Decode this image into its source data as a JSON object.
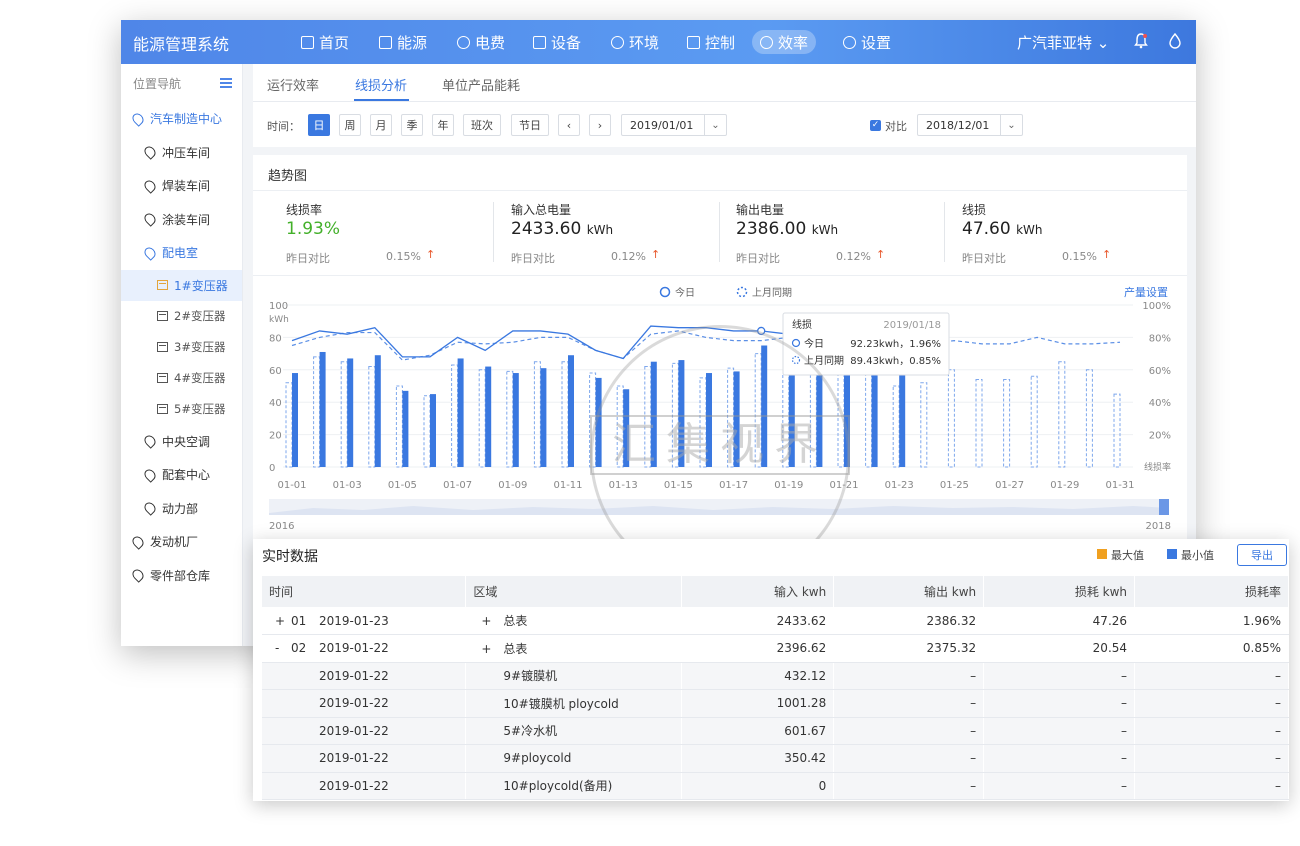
{
  "app_title": "能源管理系统",
  "nav": [
    {
      "label": "首页",
      "icon": "chart-icon"
    },
    {
      "label": "能源",
      "icon": "database-icon"
    },
    {
      "label": "电费",
      "icon": "bulb-icon"
    },
    {
      "label": "设备",
      "icon": "device-icon"
    },
    {
      "label": "环境",
      "icon": "leaf-icon"
    },
    {
      "label": "控制",
      "icon": "monitor-icon"
    },
    {
      "label": "效率",
      "icon": "clock-icon"
    },
    {
      "label": "设置",
      "icon": "gear-icon"
    }
  ],
  "company": "广汽菲亚特",
  "sidebar": {
    "header": "位置导航",
    "items": [
      {
        "label": "汽车制造中心"
      },
      {
        "label": "冲压车间"
      },
      {
        "label": "焊装车间"
      },
      {
        "label": "涂装车间"
      },
      {
        "label": "配电室"
      },
      {
        "label": "1#变压器"
      },
      {
        "label": "2#变压器"
      },
      {
        "label": "3#变压器"
      },
      {
        "label": "4#变压器"
      },
      {
        "label": "5#变压器"
      },
      {
        "label": "中央空调"
      },
      {
        "label": "配套中心"
      },
      {
        "label": "动力部"
      },
      {
        "label": "发动机厂"
      },
      {
        "label": "零件部仓库"
      }
    ]
  },
  "tabs": [
    "运行效率",
    "线损分析",
    "单位产品能耗"
  ],
  "filter": {
    "time_label": "时间：",
    "buttons": [
      "日",
      "周",
      "月",
      "季",
      "年",
      "班次",
      "节日"
    ],
    "prev": "‹",
    "next": "›",
    "date": "2019/01/01",
    "compare_label": "对比",
    "compare_date": "2018/12/01"
  },
  "trend": {
    "title": "趋势图",
    "kpis": [
      {
        "label": "线损率",
        "value": "1.93%",
        "unit": "",
        "cmp": "昨日对比",
        "pct": "0.15%"
      },
      {
        "label": "输入总电量",
        "value": "2433.60",
        "unit": "kWh",
        "cmp": "昨日对比",
        "pct": "0.12%"
      },
      {
        "label": "输出电量",
        "value": "2386.00",
        "unit": "kWh",
        "cmp": "昨日对比",
        "pct": "0.12%"
      },
      {
        "label": "线损",
        "value": "47.60",
        "unit": "kWh",
        "cmp": "昨日对比",
        "pct": "0.15%"
      }
    ],
    "arrow": "↑",
    "legend_today": "今日",
    "legend_lastmonth": "上月同期",
    "settings_link": "产量设置",
    "tooltip": {
      "title": "线损",
      "date": "2019/01/18",
      "today_label": "今日",
      "today_value": "92.23kwh，1.96%",
      "last_label": "上月同期",
      "last_value": "89.43kwh，0.85%"
    },
    "range_start": "2016",
    "range_end": "2018"
  },
  "chart_data": {
    "type": "bar",
    "categories": [
      "01-01",
      "01-02",
      "01-03",
      "01-04",
      "01-05",
      "01-06",
      "01-07",
      "01-08",
      "01-09",
      "01-10",
      "01-11",
      "01-12",
      "01-13",
      "01-14",
      "01-15",
      "01-16",
      "01-17",
      "01-18",
      "01-19",
      "01-20",
      "01-21",
      "01-22",
      "01-23",
      "01-24",
      "01-25",
      "01-26",
      "01-27",
      "01-28",
      "01-29",
      "01-30",
      "01-31"
    ],
    "tick_labels": [
      "01-01",
      "01-03",
      "01-05",
      "01-07",
      "01-09",
      "01-11",
      "01-13",
      "01-15",
      "01-17",
      "01-19",
      "01-21",
      "01-23",
      "01-25",
      "01-27",
      "01-29",
      "01-31"
    ],
    "ylabel_left": "kWh",
    "ylabel_right": "线损率",
    "left_ticks": [
      "100",
      "80",
      "60",
      "40",
      "20",
      "0"
    ],
    "right_ticks": [
      "100%",
      "80%",
      "60%",
      "40%",
      "20%"
    ],
    "ylim": [
      0,
      100
    ],
    "series": [
      {
        "name": "今日",
        "kind": "bar",
        "values": [
          58,
          71,
          67,
          69,
          47,
          45,
          67,
          62,
          58,
          61,
          69,
          55,
          48,
          65,
          66,
          58,
          59,
          75,
          60,
          60,
          64,
          69,
          57,
          null,
          null,
          null,
          null,
          null,
          null,
          null,
          null
        ]
      },
      {
        "name": "上月同期",
        "kind": "bar-dashed",
        "values": [
          52,
          68,
          65,
          62,
          50,
          44,
          63,
          60,
          59,
          65,
          65,
          58,
          50,
          62,
          64,
          55,
          61,
          70,
          58,
          61,
          63,
          66,
          50,
          52,
          60,
          54,
          54,
          56,
          65,
          60,
          45
        ]
      },
      {
        "name": "今日",
        "kind": "line",
        "values": [
          78,
          84,
          82,
          86,
          68,
          68,
          80,
          72,
          84,
          84,
          82,
          72,
          67,
          87,
          86,
          86,
          84,
          84,
          82,
          86,
          84,
          82,
          null,
          null,
          null,
          null,
          null,
          null,
          null,
          null,
          null
        ]
      },
      {
        "name": "上月同期",
        "kind": "line-dashed",
        "values": [
          75,
          80,
          83,
          83,
          66,
          69,
          77,
          76,
          77,
          80,
          80,
          72,
          67,
          82,
          84,
          80,
          78,
          78,
          80,
          84,
          80,
          81,
          80,
          76,
          78,
          76,
          76,
          80,
          76,
          76,
          77
        ]
      }
    ]
  },
  "realtime": {
    "title": "实时数据",
    "legend_max": "最大值",
    "legend_min": "最小值",
    "export": "导出",
    "colors": {
      "max": "#f0a020",
      "min": "#3a78e0"
    },
    "columns": [
      "时间",
      "区域",
      "输入 kwh",
      "输出 kwh",
      "损耗 kwh",
      "损耗率"
    ],
    "rows": [
      {
        "exp": "+",
        "idx": "01",
        "date": "2019-01-23",
        "exp2": "+",
        "area": "总表",
        "in": "2433.62",
        "out": "2386.32",
        "loss": "47.26",
        "rate": "1.96%",
        "sub": false
      },
      {
        "exp": "-",
        "idx": "02",
        "date": "2019-01-22",
        "exp2": "+",
        "area": "总表",
        "in": "2396.62",
        "out": "2375.32",
        "loss": "20.54",
        "rate": "0.85%",
        "sub": false
      },
      {
        "exp": "",
        "idx": "",
        "date": "2019-01-22",
        "exp2": "",
        "area": "9#镀膜机",
        "in": "432.12",
        "out": "–",
        "loss": "–",
        "rate": "–",
        "sub": true
      },
      {
        "exp": "",
        "idx": "",
        "date": "2019-01-22",
        "exp2": "",
        "area": "10#镀膜机 ploycold",
        "in": "1001.28",
        "out": "–",
        "loss": "–",
        "rate": "–",
        "sub": true
      },
      {
        "exp": "",
        "idx": "",
        "date": "2019-01-22",
        "exp2": "",
        "area": "5#冷水机",
        "in": "601.67",
        "out": "–",
        "loss": "–",
        "rate": "–",
        "sub": true
      },
      {
        "exp": "",
        "idx": "",
        "date": "2019-01-22",
        "exp2": "",
        "area": "9#ploycold",
        "in": "350.42",
        "out": "–",
        "loss": "–",
        "rate": "–",
        "sub": true
      },
      {
        "exp": "",
        "idx": "",
        "date": "2019-01-22",
        "exp2": "",
        "area": "10#ploycold(备用)",
        "in": "0",
        "out": "–",
        "loss": "–",
        "rate": "–",
        "sub": true
      }
    ]
  },
  "watermark": "汇集视界"
}
